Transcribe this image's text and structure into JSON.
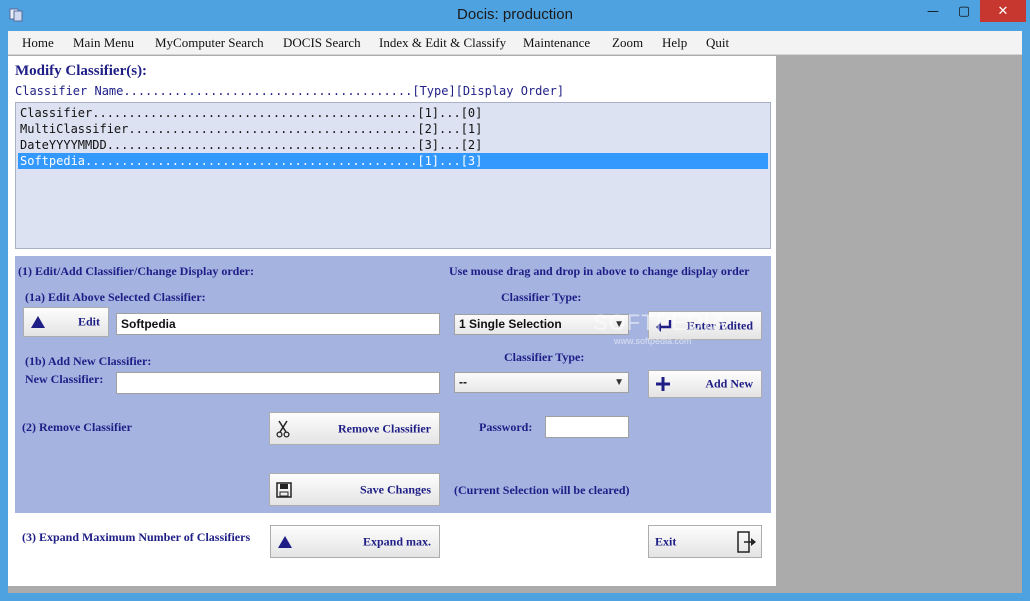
{
  "window": {
    "title": "Docis: production",
    "controls": {
      "minimize": "—",
      "maximize": "▢",
      "close": "✕"
    }
  },
  "menu": [
    "Home",
    "Main Menu",
    "MyComputer Search",
    "DOCIS Search",
    "Index & Edit & Classify",
    "Maintenance",
    "Zoom",
    "Help",
    "Quit"
  ],
  "panel": {
    "heading": "Modify Classifier(s):",
    "column_header": "Classifier Name........................................[Type][Display Order]",
    "classifiers": [
      {
        "text": "Classifier.............................................[1]...[0]",
        "selected": false
      },
      {
        "text": "MultiClassifier........................................[2]...[1]",
        "selected": false
      },
      {
        "text": "DateYYYYMMDD...........................................[3]...[2]",
        "selected": false
      },
      {
        "text": "Softpedia..............................................[1]...[3]",
        "selected": true
      }
    ]
  },
  "section1": {
    "title": "(1) Edit/Add Classifier/Change Display order:",
    "hint": "Use mouse drag and drop in above to change display order",
    "edit_title": "(1a) Edit Above Selected Classifier:",
    "edit_button": "Edit",
    "edit_value": "Softpedia",
    "type_label_edit": "Classifier Type:",
    "type_value_edit": "1 Single Selection",
    "enter_edited_button": "Enter Edited",
    "add_title": "(1b) Add New Classifier:",
    "new_classifier_label": "New Classifier:",
    "new_classifier_value": "",
    "type_label_add": "Classifier Type:",
    "type_value_add": "--",
    "add_new_button": "Add New"
  },
  "section2": {
    "title": "(2) Remove Classifier",
    "remove_button": "Remove Classifier",
    "password_label": "Password:",
    "password_value": "",
    "save_button": "Save Changes",
    "save_note": "(Current Selection will be cleared)"
  },
  "section3": {
    "title": "(3) Expand Maximum Number of Classifiers",
    "expand_button": "Expand max.",
    "exit_button": "Exit"
  },
  "watermark": {
    "text": "SOFTPEDIA",
    "sub": "www.softpedia.com"
  },
  "colors": {
    "titlebar": "#4ea2e0",
    "accent_text": "#1e1e86",
    "selection": "#3399ff",
    "blue_area": "#a5b3e0",
    "listbox": "#dde2f2",
    "close": "#c7372f"
  }
}
